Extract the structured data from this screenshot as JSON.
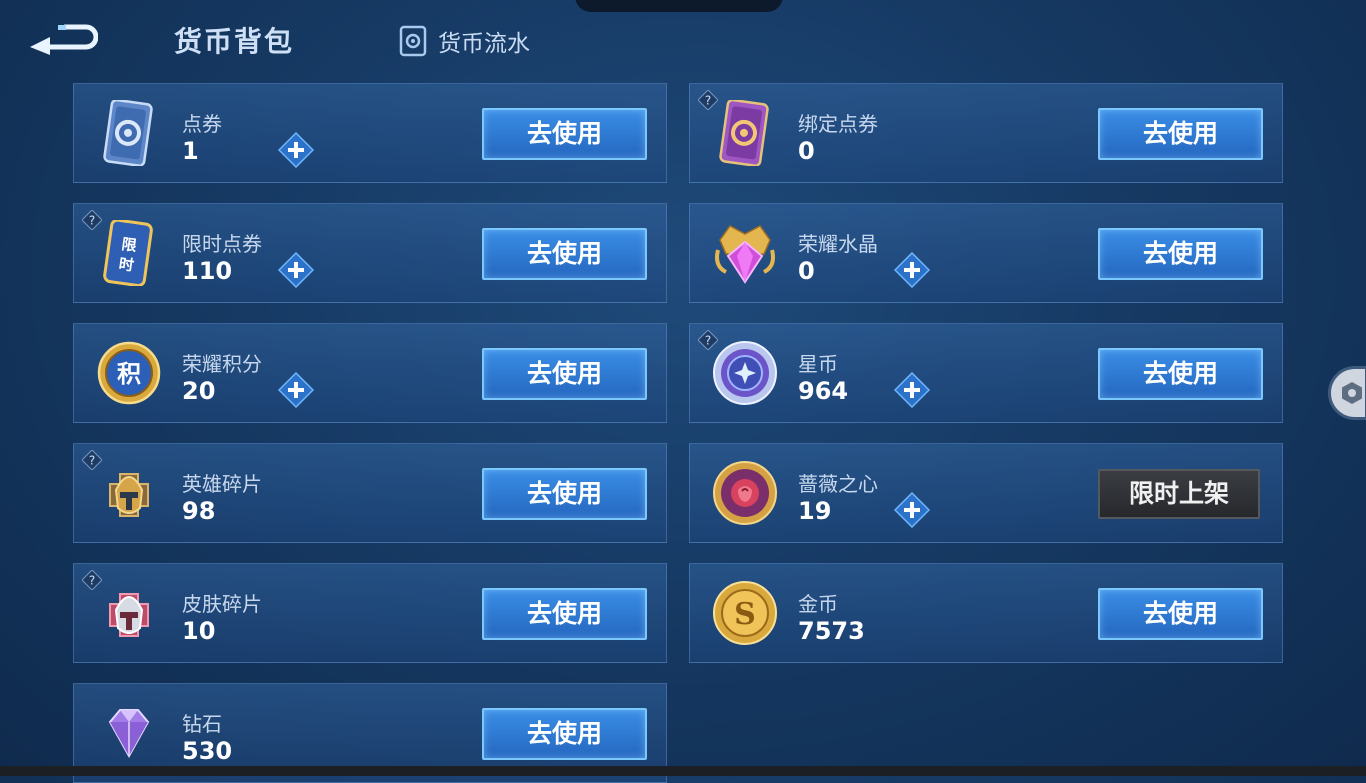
{
  "header": {
    "title": "货币背包",
    "flow_label": "货币流水"
  },
  "use_label": "去使用",
  "cards": [
    {
      "name": "点券",
      "amount": "1",
      "help": false,
      "plus": true,
      "button": "去使用",
      "icon": "coupon-card-icon"
    },
    {
      "name": "绑定点券",
      "amount": "0",
      "help": true,
      "plus": false,
      "button": "去使用",
      "icon": "bound-coupon-card-icon"
    },
    {
      "name": "限时点券",
      "amount": "110",
      "help": true,
      "plus": true,
      "button": "去使用",
      "icon": "limited-coupon-icon",
      "icon_text": "限时"
    },
    {
      "name": "荣耀水晶",
      "amount": "0",
      "help": false,
      "plus": true,
      "button": "去使用",
      "icon": "glory-crystal-icon"
    },
    {
      "name": "荣耀积分",
      "amount": "20",
      "help": false,
      "plus": true,
      "button": "去使用",
      "icon": "glory-points-icon",
      "icon_text": "积"
    },
    {
      "name": "星币",
      "amount": "964",
      "help": true,
      "plus": true,
      "button": "去使用",
      "icon": "star-coin-icon"
    },
    {
      "name": "英雄碎片",
      "amount": "98",
      "help": true,
      "plus": false,
      "button": "去使用",
      "icon": "hero-fragment-icon"
    },
    {
      "name": "蔷薇之心",
      "amount": "19",
      "help": false,
      "plus": true,
      "button": "限时上架",
      "icon": "rose-heart-icon",
      "button_dark": true
    },
    {
      "name": "皮肤碎片",
      "amount": "10",
      "help": true,
      "plus": false,
      "button": "去使用",
      "icon": "skin-fragment-icon"
    },
    {
      "name": "金币",
      "amount": "7573",
      "help": false,
      "plus": false,
      "button": "去使用",
      "icon": "gold-coin-icon"
    },
    {
      "name": "钻石",
      "amount": "530",
      "help": false,
      "plus": false,
      "button": "去使用",
      "icon": "diamond-icon"
    }
  ],
  "colors": {
    "button_blue": "#2f7fd8",
    "button_border": "#7bc8ff",
    "plus_blue": "#2b72c8"
  }
}
